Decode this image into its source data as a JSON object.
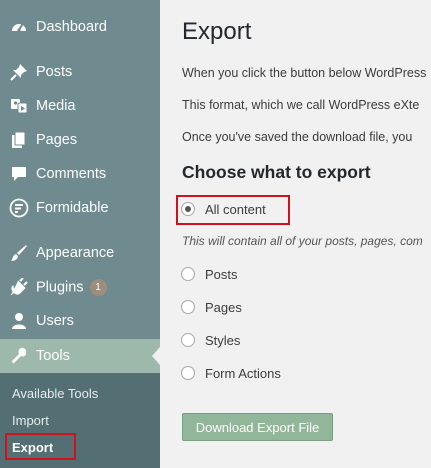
{
  "sidebar": {
    "items": [
      {
        "label": "Dashboard",
        "icon": "dashboard-icon"
      },
      {
        "label": "Posts",
        "icon": "pin-icon"
      },
      {
        "label": "Media",
        "icon": "media-icon"
      },
      {
        "label": "Pages",
        "icon": "pages-icon"
      },
      {
        "label": "Comments",
        "icon": "comment-icon"
      },
      {
        "label": "Formidable",
        "icon": "formidable-icon"
      },
      {
        "label": "Appearance",
        "icon": "brush-icon"
      },
      {
        "label": "Plugins",
        "icon": "plug-icon",
        "badge": "1"
      },
      {
        "label": "Users",
        "icon": "user-icon"
      },
      {
        "label": "Tools",
        "icon": "wrench-icon",
        "active": true
      }
    ],
    "submenu": {
      "items": [
        {
          "label": "Available Tools"
        },
        {
          "label": "Import"
        },
        {
          "label": "Export",
          "current": true
        }
      ]
    }
  },
  "main": {
    "title": "Export",
    "paragraphs": [
      "When you click the button below WordPress",
      "This format, which we call WordPress eXte",
      "Once you've saved the download file, you"
    ],
    "section_title": "Choose what to export",
    "options": [
      {
        "label": "All content",
        "checked": true
      },
      {
        "label": "Posts",
        "checked": false
      },
      {
        "label": "Pages",
        "checked": false
      },
      {
        "label": "Styles",
        "checked": false
      },
      {
        "label": "Form Actions",
        "checked": false
      }
    ],
    "all_content_description": "This will contain all of your posts, pages, com",
    "download_button": "Download Export File"
  },
  "colors": {
    "sidebar_bg": "#6f8b8f",
    "submenu_bg": "#536f73",
    "active_item_bg": "#9cb9ac",
    "highlight_border": "#d1111b",
    "button_bg": "#92b69a"
  }
}
